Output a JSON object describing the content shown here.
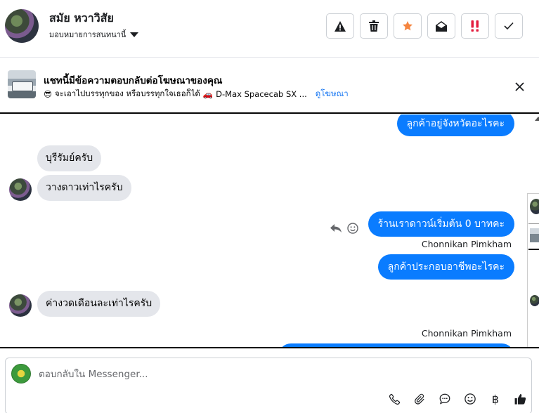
{
  "header": {
    "contact_name": "สมัย หวาวิสัย",
    "assign_label": "มอบหมายการสนทนานี้",
    "actions": {
      "spam": "warning-icon",
      "delete": "trash-icon",
      "star": "star-icon",
      "unread": "envelope-open-icon",
      "follow_up": "double-exclamation-icon",
      "done": "check-icon"
    },
    "colors": {
      "star": "#f5853f",
      "follow_up": "#e41e3f"
    }
  },
  "ad_banner": {
    "title": "แชทนี้มีข้อความตอบกลับต่อโฆษณาของคุณ",
    "subtitle": "จะเอาไปบรรทุกของ หรือบรรทุกใจเธอก็ได้",
    "car_text": "D-Max Spacecab SX ...",
    "link_label": "ดูโฆษณา",
    "emoji_glasses": "😎",
    "emoji_car": "🚗"
  },
  "messages": [
    {
      "side": "out",
      "text": "ลูกค้าอยู่จังหวัดอะไรคะ"
    },
    {
      "side": "in",
      "text": "บุรีรัมย์ครับ"
    },
    {
      "side": "in",
      "text": "วางดาวเท่าไรครับ"
    },
    {
      "side": "out",
      "text": "ร้านเราดาวน์เริ่มต้น 0 บาทคะ",
      "sender": "Chonnikan Pimkham"
    },
    {
      "side": "out",
      "text": "ลูกค้าประกอบอาชีพอะไรคะ"
    },
    {
      "side": "in",
      "text": "ค่างวดเดือนละเท่าไรครับ"
    },
    {
      "side": "out",
      "text": "",
      "sender": "Chonnikan Pimkham"
    }
  ],
  "composer": {
    "placeholder": "ตอบกลับใน Messenger...",
    "tools": [
      "phone-icon",
      "paperclip-icon",
      "saved-reply-icon",
      "emoji-icon",
      "baht-icon",
      "thumbs-up-icon"
    ],
    "baht_symbol": "฿"
  },
  "colors": {
    "accent": "#0a7cff",
    "incoming_bubble": "#e4e6eb",
    "link": "#1877f2"
  }
}
